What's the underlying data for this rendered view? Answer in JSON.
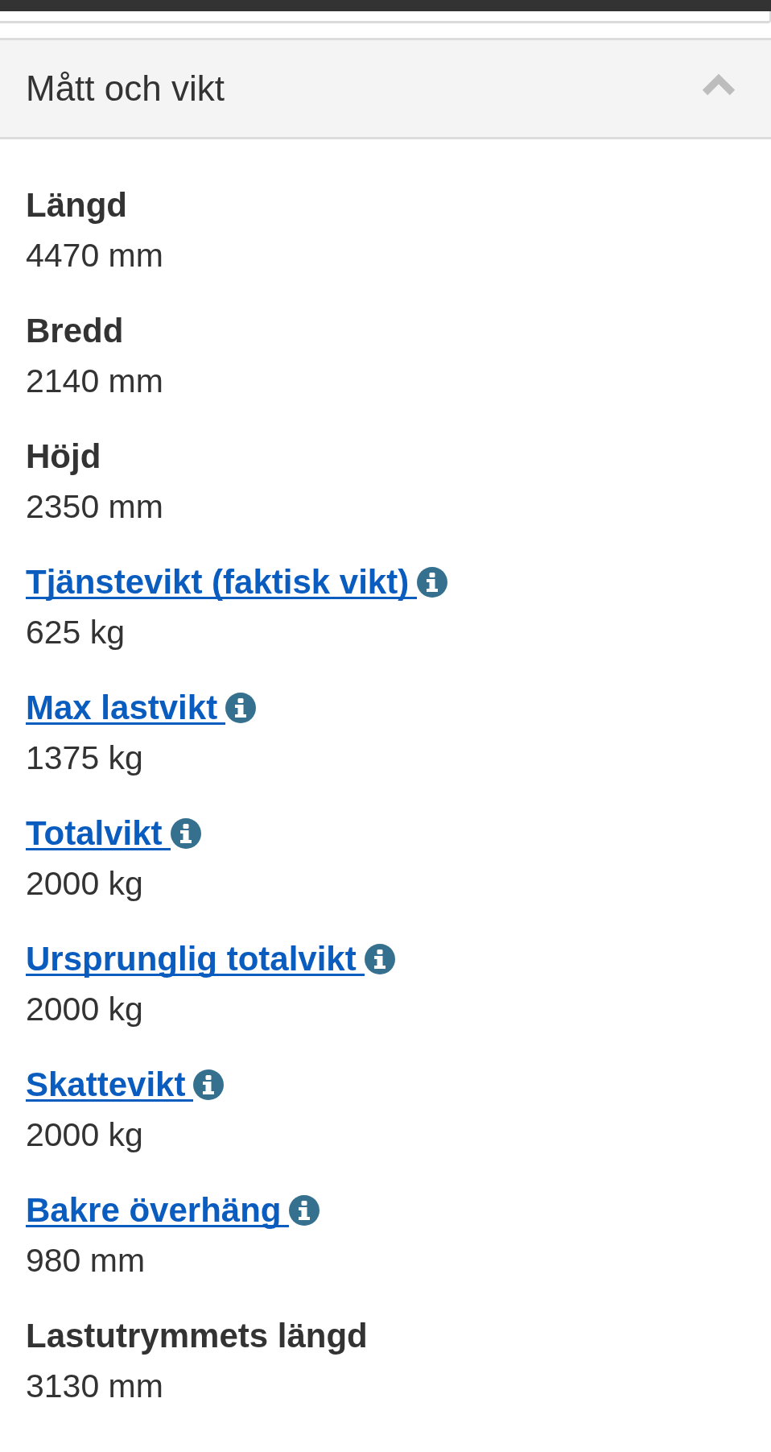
{
  "section": {
    "title": "Mått och vikt",
    "expanded": true
  },
  "specs": [
    {
      "kind": "text",
      "label": "Längd",
      "value": "4470 mm"
    },
    {
      "kind": "text",
      "label": "Bredd",
      "value": "2140 mm"
    },
    {
      "kind": "text",
      "label": "Höjd",
      "value": "2350 mm"
    },
    {
      "kind": "link",
      "label": "Tjänstevikt (faktisk vikt)",
      "value": "625 kg"
    },
    {
      "kind": "link",
      "label": "Max lastvikt",
      "value": "1375 kg"
    },
    {
      "kind": "link",
      "label": "Totalvikt",
      "value": "2000 kg"
    },
    {
      "kind": "link",
      "label": "Ursprunglig totalvikt",
      "value": "2000 kg"
    },
    {
      "kind": "link",
      "label": "Skattevikt",
      "value": "2000 kg"
    },
    {
      "kind": "link",
      "label": "Bakre överhäng",
      "value": "980 mm"
    },
    {
      "kind": "text",
      "label": "Lastutrymmets längd",
      "value": "3130 mm"
    }
  ]
}
